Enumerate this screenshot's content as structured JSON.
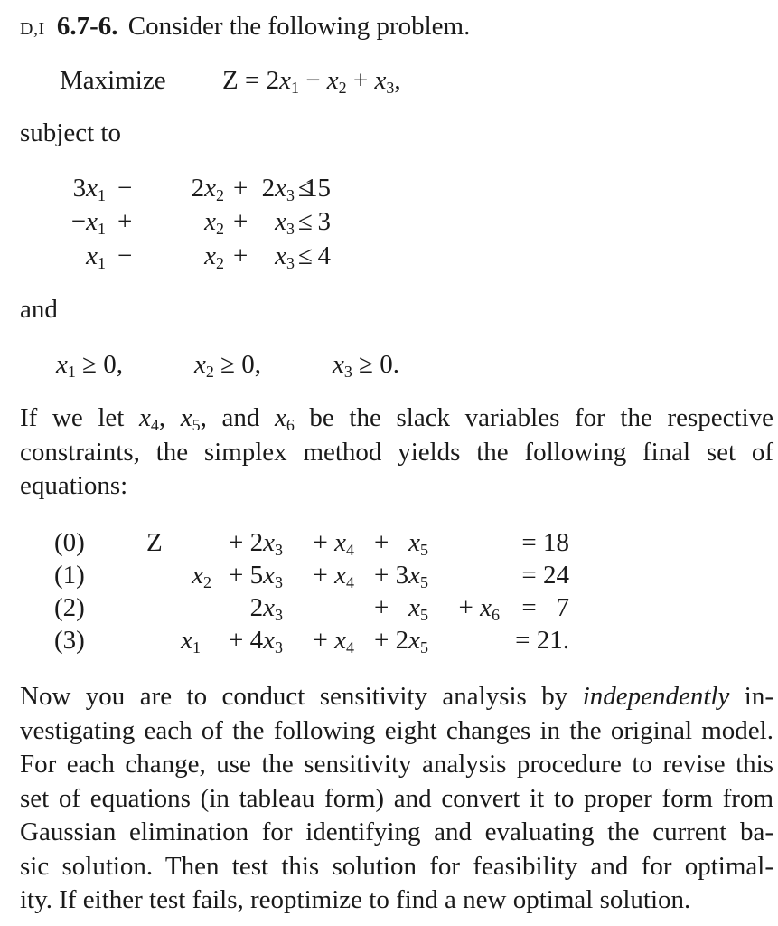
{
  "problem": {
    "tag": "D,I",
    "number": "6.7-6.",
    "intro": "Consider the following problem."
  },
  "objective": {
    "label": "Maximize",
    "expression_html": "Z = 2<i>x</i><sub>1</sub> − <i>x</i><sub>2</sub> + <i>x</i><sub>3</sub>,"
  },
  "subject_to_label": "subject to",
  "constraints": [
    {
      "c1": "3<i>x</i><sub>1</sub>",
      "op1": "−",
      "c2": "2<i>x</i><sub>2</sub>",
      "op2": "+",
      "c3": "2<i>x</i><sub>3</sub>",
      "rel": "≤",
      "rhs": "15"
    },
    {
      "c1": "−<i>x</i><sub>1</sub>",
      "op1": "+",
      "c2": "<i>x</i><sub>2</sub>",
      "op2": "+",
      "c3": "<i>x</i><sub>3</sub>",
      "rel": "≤",
      "rhs": "3"
    },
    {
      "c1": "<i>x</i><sub>1</sub>",
      "op1": "−",
      "c2": "<i>x</i><sub>2</sub>",
      "op2": "+",
      "c3": "<i>x</i><sub>3</sub>",
      "rel": "≤",
      "rhs": "4"
    }
  ],
  "and_label": "and",
  "nonnegativity": [
    "<i>x</i><sub>1</sub> ≥ 0,",
    "<i>x</i><sub>2</sub> ≥ 0,",
    "<i>x</i><sub>3</sub> ≥ 0."
  ],
  "slack_paragraph_lines": [
    "If we let <i>x</i><sub>4</sub>, <i>x</i><sub>5</sub>, and <i>x</i><sub>6</sub> be the slack variables for the respective",
    "constraints, the simplex method yields the following final set of",
    "equations:"
  ],
  "final_equations": [
    {
      "label": "(0)",
      "Z": "Z",
      "x1": "",
      "x2": "",
      "x3": "+ 2<i>x</i><sub>3</sub>",
      "x4": "+ <i>x</i><sub>4</sub>",
      "x5": "+ &nbsp;&nbsp;<i>x</i><sub>5</sub>",
      "x6": "",
      "rhs": "= 18"
    },
    {
      "label": "(1)",
      "Z": "",
      "x1": "",
      "x2": "<i>x</i><sub>2</sub>",
      "x3": "+ 5<i>x</i><sub>3</sub>",
      "x4": "+ <i>x</i><sub>4</sub>",
      "x5": "+ 3<i>x</i><sub>5</sub>",
      "x6": "",
      "rhs": "= 24"
    },
    {
      "label": "(2)",
      "Z": "",
      "x1": "",
      "x2": "",
      "x3": "2<i>x</i><sub>3</sub>",
      "x4": "",
      "x5": "+ &nbsp;&nbsp;<i>x</i><sub>5</sub>",
      "x6": "+ <i>x</i><sub>6</sub>",
      "rhs": "= &nbsp;&nbsp;7"
    },
    {
      "label": "(3)",
      "Z": "",
      "x1": "<i>x</i><sub>1</sub>",
      "x2": "",
      "x3": "+ 4<i>x</i><sub>3</sub>",
      "x4": "+ <i>x</i><sub>4</sub>",
      "x5": "+ 2<i>x</i><sub>5</sub>",
      "x6": "",
      "rhs": "= 21."
    }
  ],
  "instructions_paragraph_lines": [
    "Now you are to conduct sensitivity analysis by <i>independently</i> in-",
    "vestigating each of the following eight changes in the original model.",
    "For each change, use the sensitivity analysis procedure to revise this",
    "set of equations (in tableau form) and convert it to proper form from",
    "Gaussian elimination for identifying and evaluating the current ba-",
    "sic solution. Then test this solution for feasibility and for optimal-",
    "ity. If either test fails, reoptimize to find a new optimal solution."
  ]
}
